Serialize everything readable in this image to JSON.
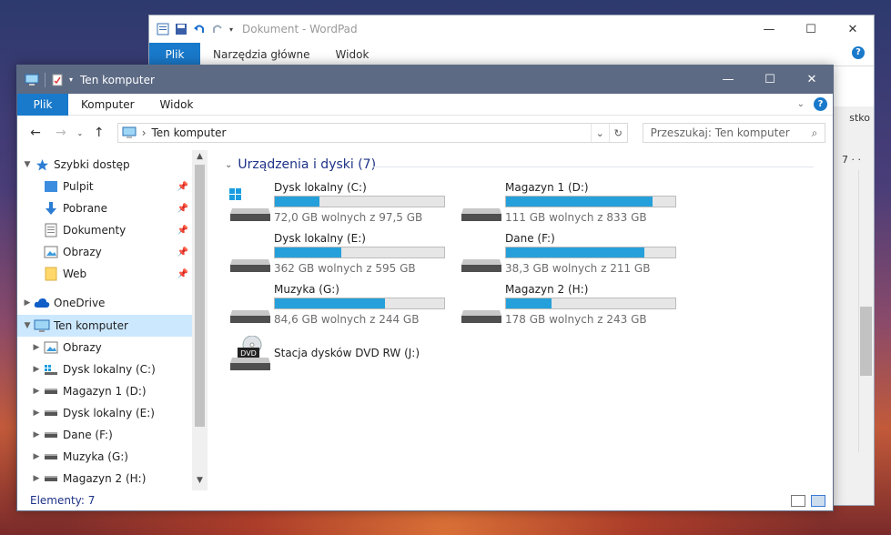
{
  "wordpad": {
    "title": "Dokument - WordPad",
    "tabs": [
      {
        "label": "Plik"
      },
      {
        "label": "Narzędzia główne"
      },
      {
        "label": "Widok"
      }
    ],
    "help": "?",
    "fragment_text": "stko",
    "fragment_ruler": "7 · ·",
    "window_controls": {
      "minimize": "—",
      "maximize": "☐",
      "close": "✕"
    }
  },
  "explorer": {
    "title": "Ten komputer",
    "window_controls": {
      "minimize": "—",
      "maximize": "☐",
      "close": "✕"
    },
    "tabs": [
      {
        "label": "Plik"
      },
      {
        "label": "Komputer"
      },
      {
        "label": "Widok"
      }
    ],
    "help": "?",
    "address": {
      "separator": "›",
      "path": "Ten komputer"
    },
    "search_placeholder": "Przeszukaj: Ten komputer",
    "tree": [
      {
        "label": "Szybki dostęp",
        "icon": "star-icon",
        "level": 0,
        "expanded": true
      },
      {
        "label": "Pulpit",
        "icon": "desktop-folder-icon",
        "level": 1,
        "pinned": true
      },
      {
        "label": "Pobrane",
        "icon": "download-arrow-icon",
        "level": 1,
        "pinned": true
      },
      {
        "label": "Dokumenty",
        "icon": "documents-icon",
        "level": 1,
        "pinned": true
      },
      {
        "label": "Obrazy",
        "icon": "pictures-icon",
        "level": 1,
        "pinned": true
      },
      {
        "label": "Web",
        "icon": "folder-icon",
        "level": 1,
        "pinned": true
      },
      {
        "label": "OneDrive",
        "icon": "cloud-icon",
        "level": 0,
        "expanded": false
      },
      {
        "label": "Ten komputer",
        "icon": "computer-icon",
        "level": 0,
        "expanded": true,
        "selected": true
      },
      {
        "label": "Obrazy",
        "icon": "pictures-icon",
        "level": 1
      },
      {
        "label": "Dysk lokalny (C:)",
        "icon": "windows-drive-icon",
        "level": 1
      },
      {
        "label": "Magazyn 1 (D:)",
        "icon": "drive-icon",
        "level": 1
      },
      {
        "label": "Dysk lokalny (E:)",
        "icon": "drive-icon",
        "level": 1
      },
      {
        "label": "Dane (F:)",
        "icon": "drive-icon",
        "level": 1
      },
      {
        "label": "Muzyka (G:)",
        "icon": "drive-icon",
        "level": 1
      },
      {
        "label": "Magazyn 2 (H:)",
        "icon": "drive-icon",
        "level": 1
      }
    ],
    "group": {
      "title": "Urządzenia i dyski (7)"
    },
    "drives": [
      {
        "name": "Dysk lokalny (C:)",
        "space": "72,0 GB wolnych z 97,5 GB",
        "used_fraction": 0.262,
        "icon": "windows-drive-icon"
      },
      {
        "name": "Magazyn 1 (D:)",
        "space": "111 GB wolnych z 833 GB",
        "used_fraction": 0.867,
        "icon": "drive-icon"
      },
      {
        "name": "Dysk lokalny (E:)",
        "space": "362 GB wolnych z 595 GB",
        "used_fraction": 0.392,
        "icon": "drive-icon"
      },
      {
        "name": "Dane (F:)",
        "space": "38,3 GB wolnych z 211 GB",
        "used_fraction": 0.818,
        "icon": "drive-icon"
      },
      {
        "name": "Muzyka (G:)",
        "space": "84,6 GB wolnych z 244 GB",
        "used_fraction": 0.653,
        "icon": "drive-icon"
      },
      {
        "name": "Magazyn 2 (H:)",
        "space": "178 GB wolnych z 243 GB",
        "used_fraction": 0.267,
        "icon": "drive-icon"
      }
    ],
    "dvd": {
      "name": "Stacja dysków DVD RW (J:)",
      "badge": "DVD"
    },
    "status": "Elementy: 7"
  }
}
